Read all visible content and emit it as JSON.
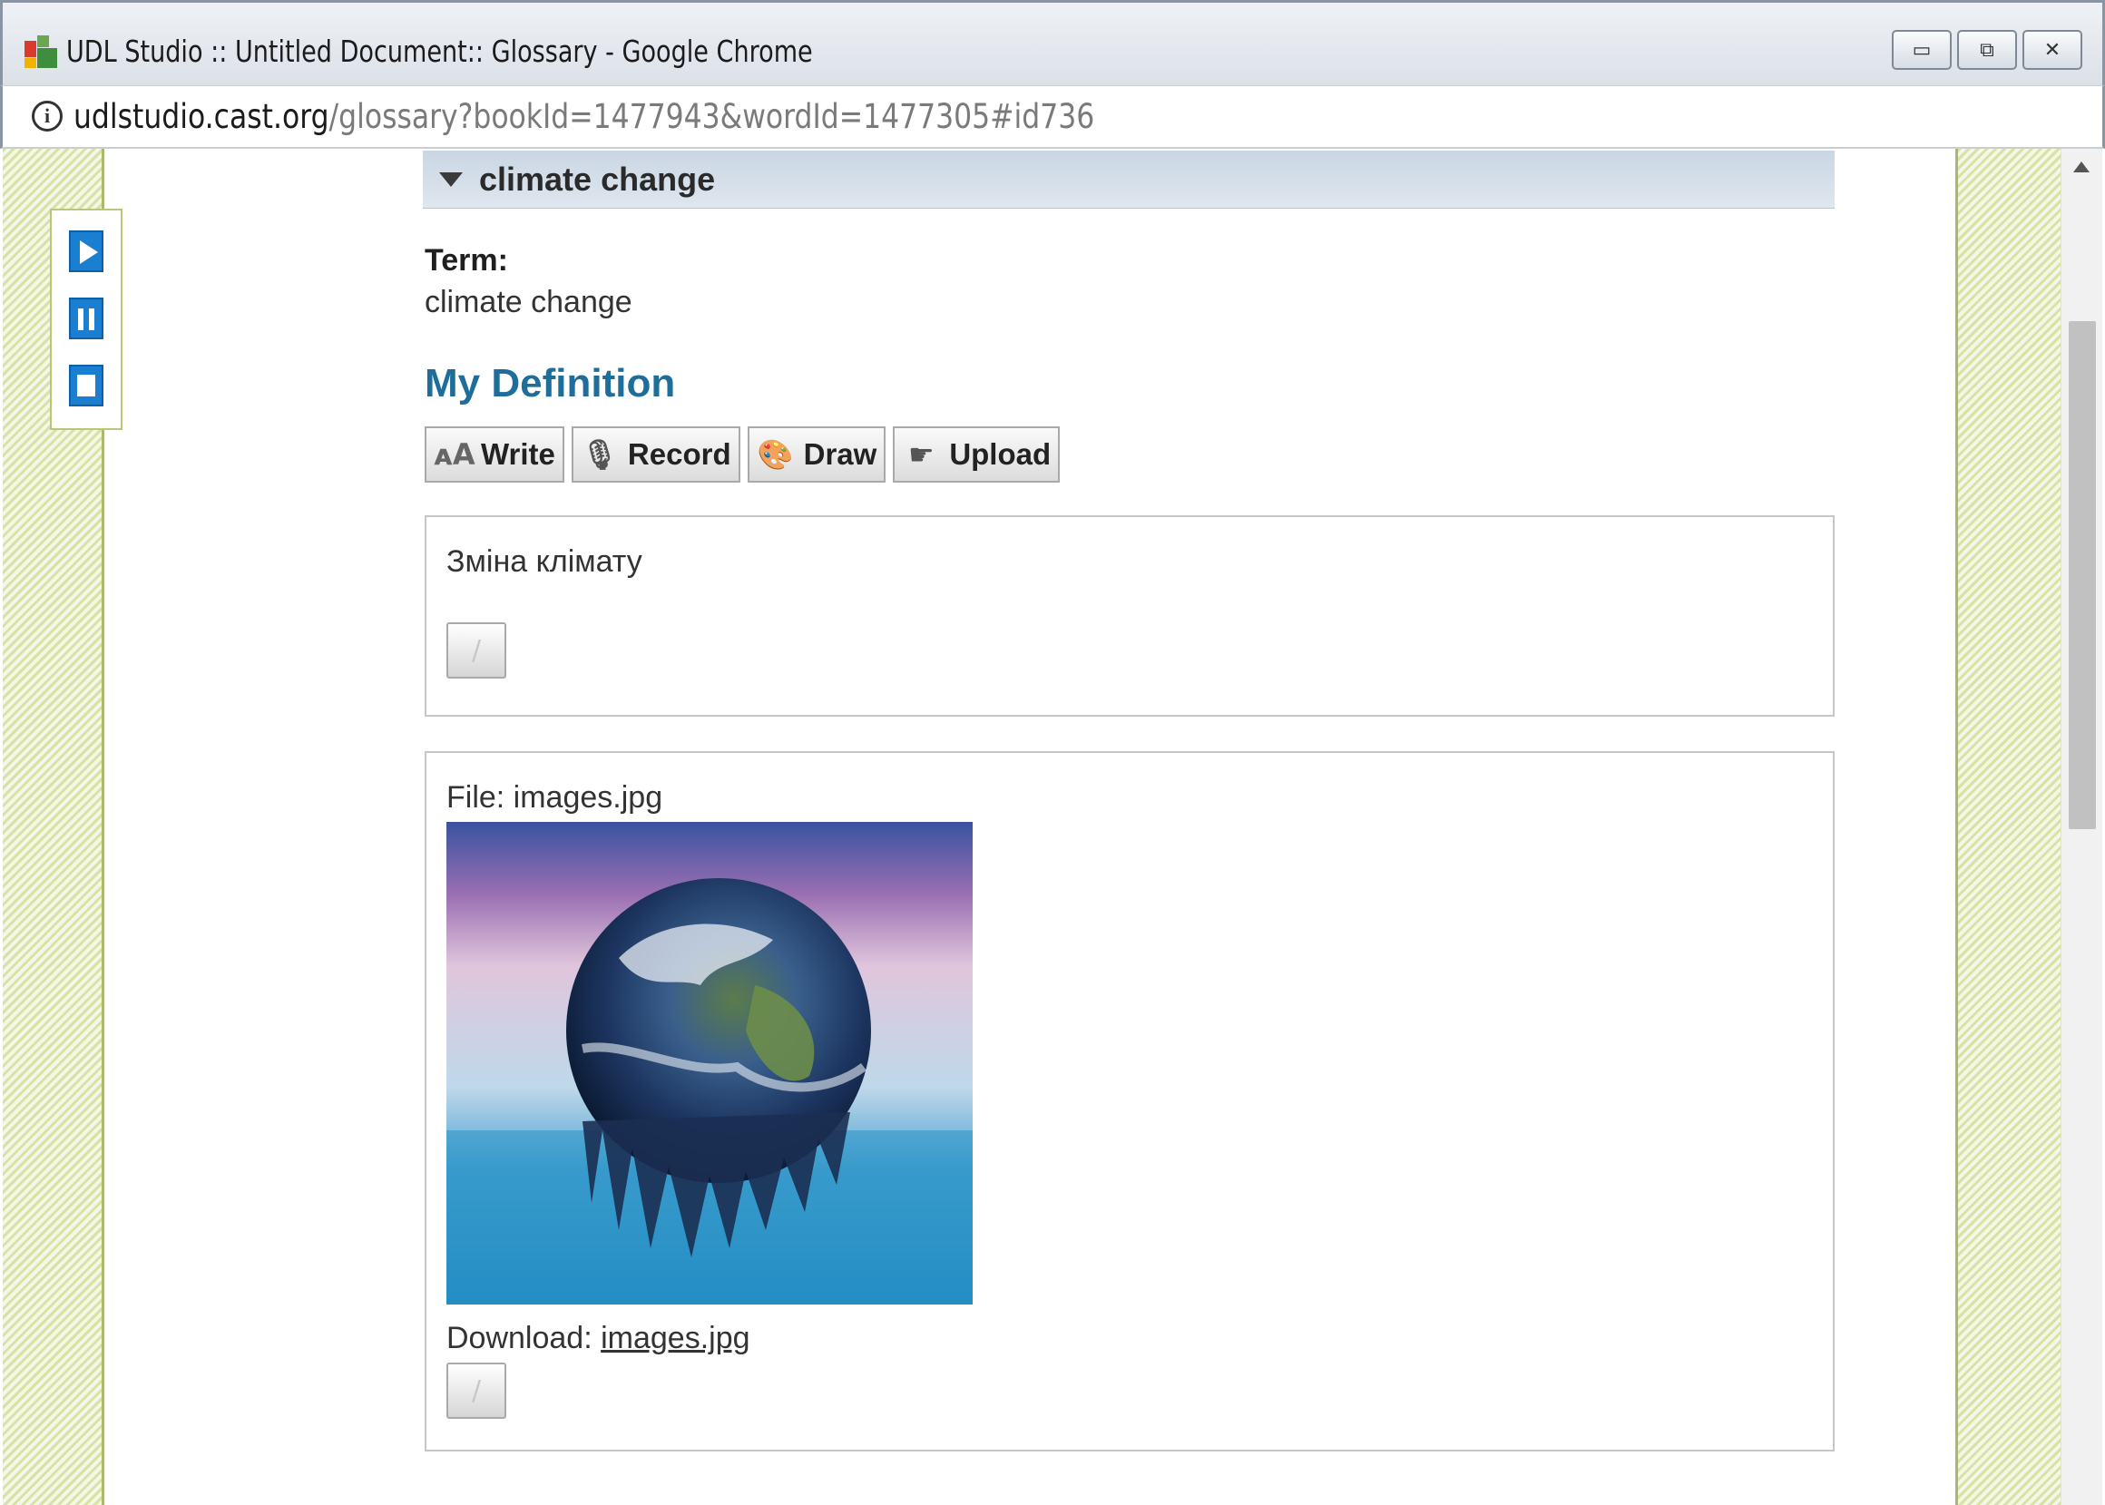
{
  "window": {
    "title": "UDL Studio :: Untitled Document:: Glossary - Google Chrome",
    "controls": {
      "minimize": "▭",
      "maximize": "⧉",
      "close": "✕"
    }
  },
  "address": {
    "host": "udlstudio.cast.org",
    "path": "/glossary?bookId=1477943&wordId=1477305#id736"
  },
  "player": {
    "icons": [
      "play-icon",
      "pause-icon",
      "stop-icon"
    ]
  },
  "section": {
    "title": "climate change"
  },
  "term": {
    "label": "Term:",
    "value": "climate change"
  },
  "definition": {
    "heading": "My Definition",
    "toolbar": [
      {
        "label": "Write",
        "icon": "font-size-icon"
      },
      {
        "label": "Record",
        "icon": "microphone-icon"
      },
      {
        "label": "Draw",
        "icon": "palette-icon"
      },
      {
        "label": "Upload",
        "icon": "upload-icon"
      }
    ]
  },
  "entries": {
    "text_entry": "Зміна клімату",
    "file_label": "File: images.jpg",
    "download_label": "Download:",
    "download_link": "images.jpg"
  }
}
